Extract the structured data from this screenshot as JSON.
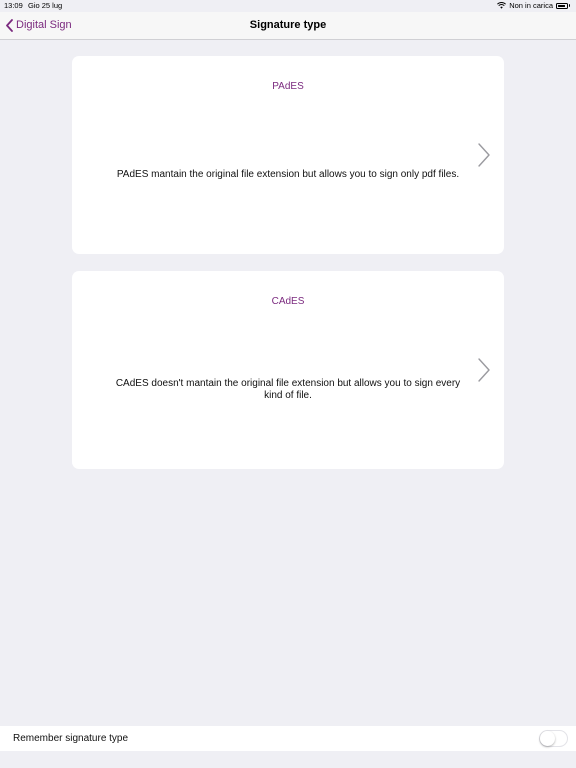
{
  "status_bar": {
    "time": "13:09",
    "date": "Gio 25 lug",
    "charging_text": "Non in carica",
    "wifi_icon": "wifi-icon",
    "battery_icon": "battery-icon"
  },
  "nav": {
    "back_label": "Digital Sign",
    "back_icon": "chevron-left-icon",
    "title": "Signature type",
    "accent_color": "#7b2a7f"
  },
  "cards": [
    {
      "title": "PAdES",
      "description": "PAdES mantain the original file extension but allows you to sign only pdf files."
    },
    {
      "title": "CAdES",
      "description": "CAdES doesn't mantain the original file extension but allows you to sign every kind of file."
    }
  ],
  "footer": {
    "remember_label": "Remember signature type",
    "toggle_on": false
  }
}
